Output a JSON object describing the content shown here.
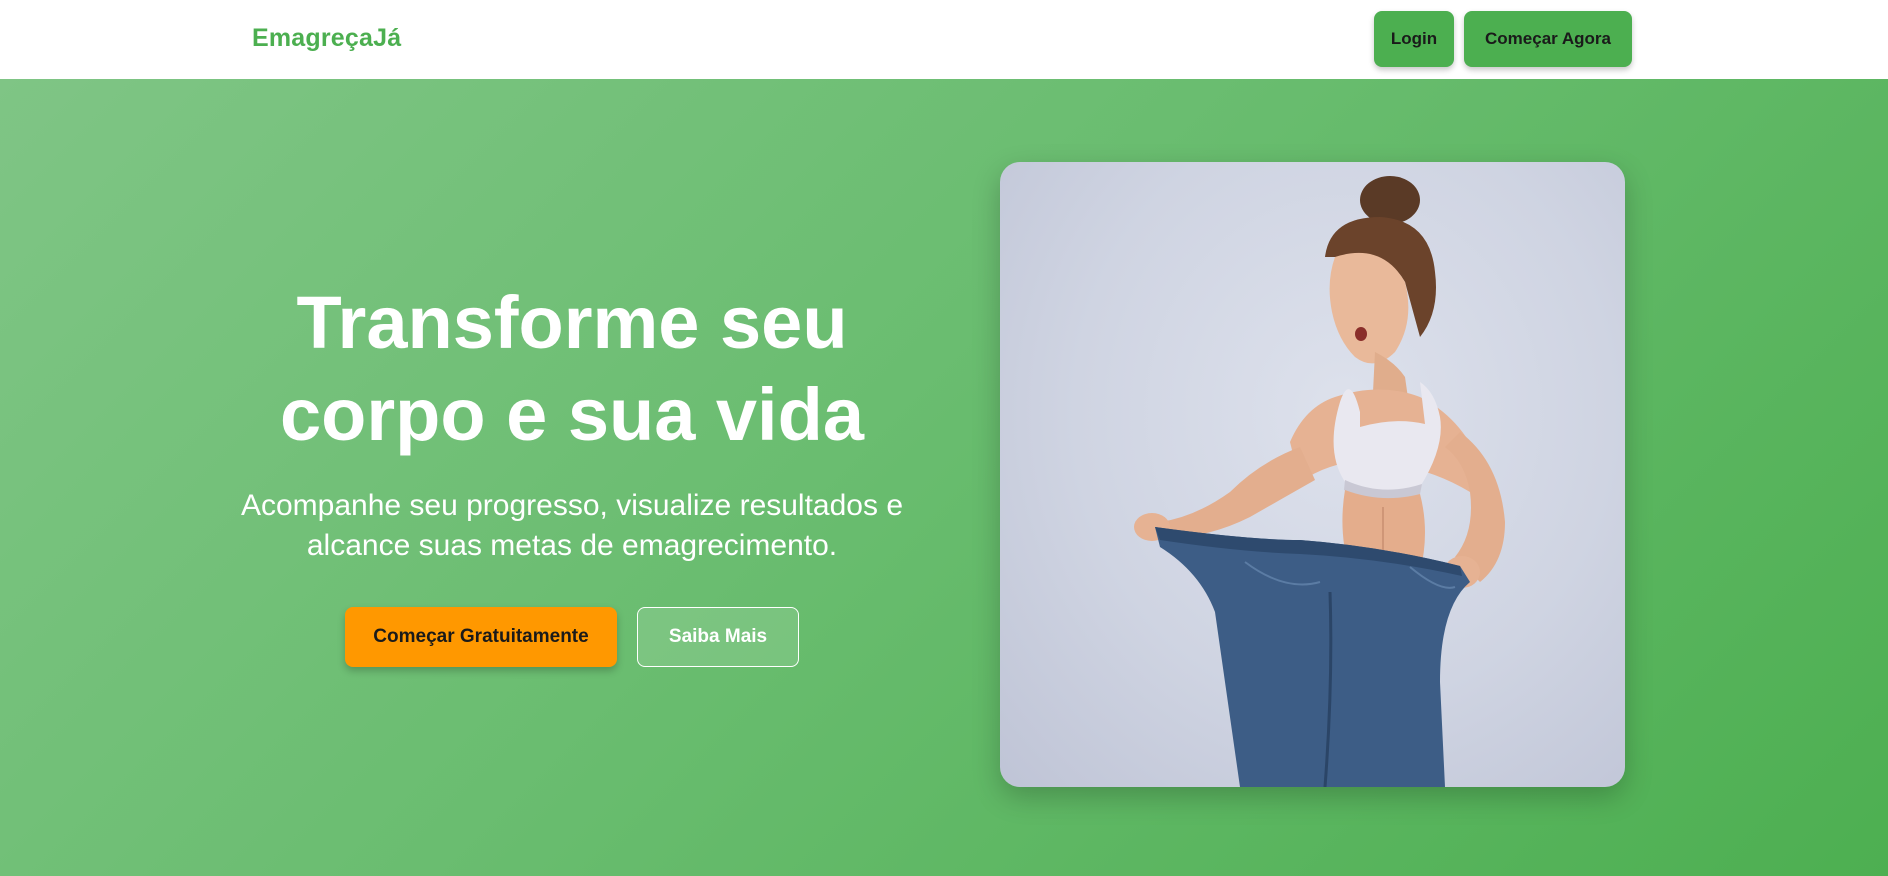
{
  "navbar": {
    "brand": "EmagreçaJá",
    "login_label": "Login",
    "start_label": "Começar Agora"
  },
  "hero": {
    "headline": "Transforme seu\ncorpo e sua vida",
    "subtitle": "Acompanhe seu progresso, visualize resultados e\nalcance suas metas de emagrecimento.",
    "primary_cta": "Começar Gratuitamente",
    "secondary_cta": "Saiba Mais",
    "image_subject": "woman-holding-oversized-jeans-photo"
  },
  "colors": {
    "brand_green": "#4caf50",
    "hero_gradient_start": "#7fc585",
    "hero_gradient_end": "#4daf51",
    "primary_cta_orange": "#ff9800",
    "text_dark": "#1a1a1a",
    "text_light": "#ffffff"
  }
}
